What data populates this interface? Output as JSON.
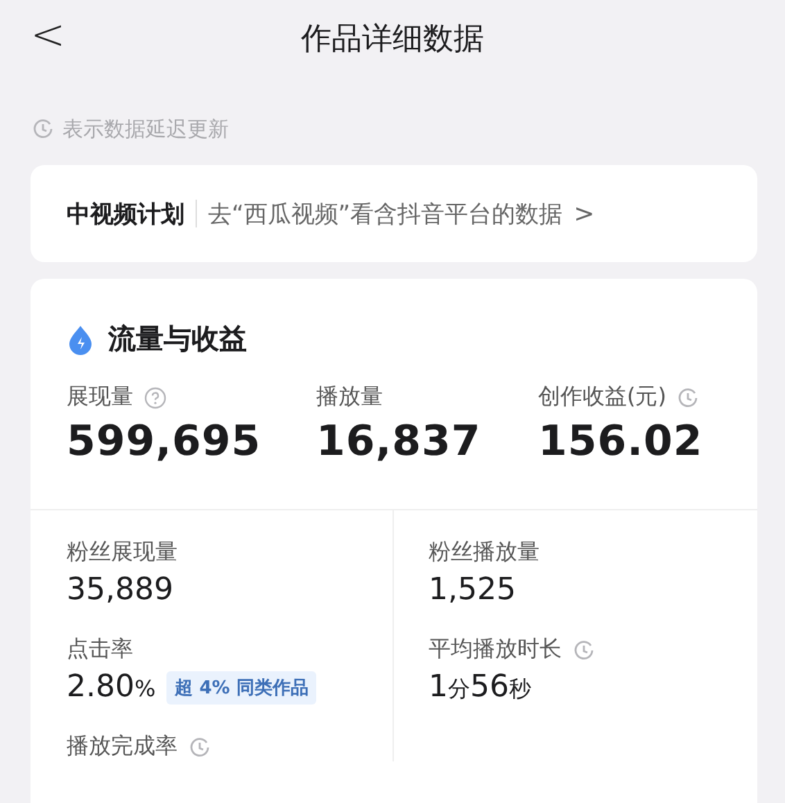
{
  "header": {
    "back": "<",
    "title": "作品详细数据"
  },
  "notice": {
    "text": "表示数据延迟更新"
  },
  "plan_card": {
    "name": "中视频计划",
    "link": "去“西瓜视频”看含抖音平台的数据",
    "chevron": ">"
  },
  "traffic_card": {
    "title": "流量与收益",
    "main_metrics": [
      {
        "label": "展现量",
        "kind": "help",
        "value": "599,695"
      },
      {
        "label": "播放量",
        "kind": "plain",
        "value": "16,837"
      },
      {
        "label": "创作收益(元)",
        "kind": "delayed",
        "value": "156.02"
      }
    ],
    "detail_metrics": [
      {
        "label": "粉丝展现量",
        "kind": "plain",
        "value": [
          {
            "text": "35,889",
            "kind": "number"
          }
        ]
      },
      {
        "label": "粉丝播放量",
        "kind": "plain",
        "value": [
          {
            "text": "1,525",
            "kind": "number"
          }
        ]
      },
      {
        "label": "点击率",
        "kind": "plain",
        "value": [
          {
            "text": "2.80",
            "kind": "number"
          },
          {
            "text": "%",
            "kind": "unit"
          }
        ],
        "badge": "超 4% 同类作品"
      },
      {
        "label": "平均播放时长",
        "kind": "delayed",
        "value": [
          {
            "text": "1",
            "kind": "number"
          },
          {
            "text": "分",
            "kind": "unit"
          },
          {
            "text": "56",
            "kind": "number"
          },
          {
            "text": "秒",
            "kind": "unit"
          }
        ]
      },
      {
        "label": "播放完成率",
        "kind": "delayed"
      }
    ]
  }
}
